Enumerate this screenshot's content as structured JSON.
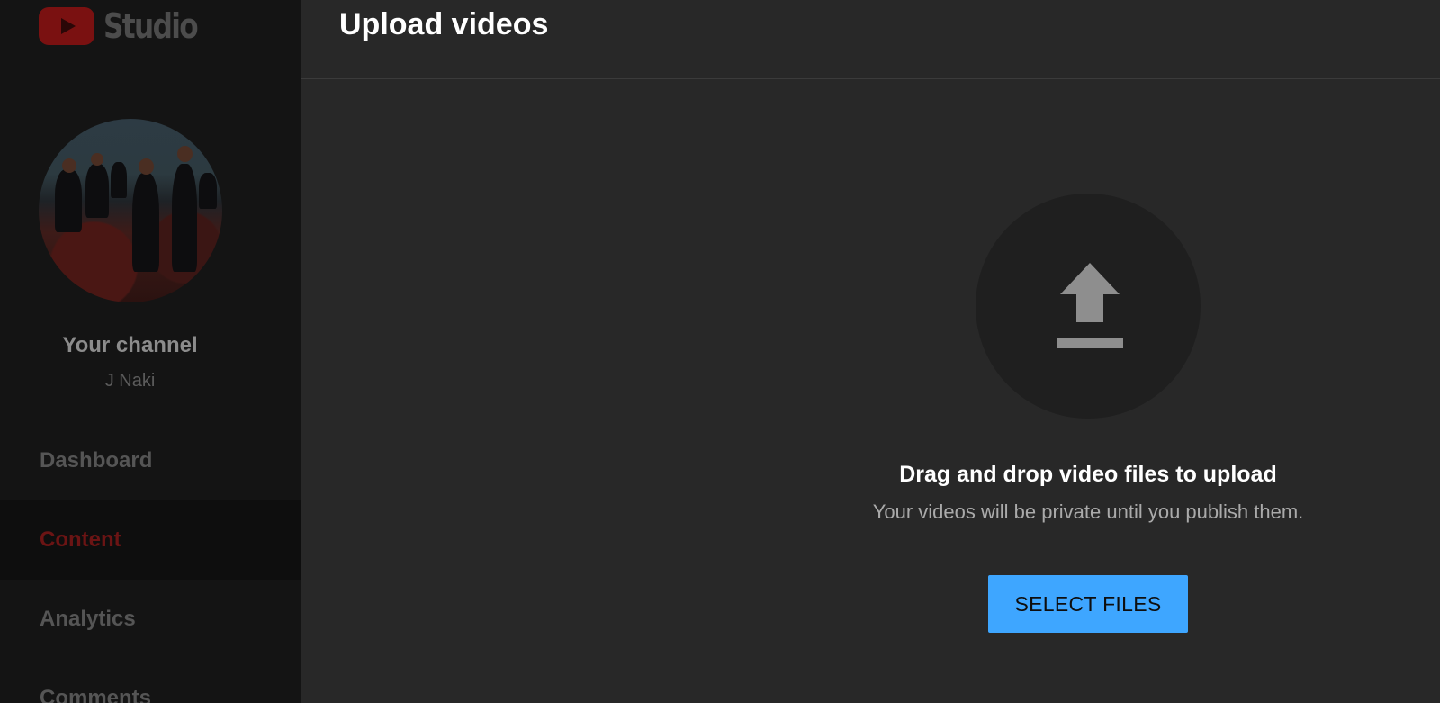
{
  "brand": {
    "logo_text": "Studio"
  },
  "channel": {
    "title": "Your channel",
    "name": "J Naki"
  },
  "sidebar": {
    "items": [
      {
        "label": "Dashboard",
        "active": false
      },
      {
        "label": "Content",
        "active": true
      },
      {
        "label": "Analytics",
        "active": false
      },
      {
        "label": "Comments",
        "active": false
      }
    ]
  },
  "modal": {
    "title": "Upload videos",
    "upload_icon": "upload-arrow-icon",
    "drop_title": "Drag and drop video files to upload",
    "drop_subtitle": "Your videos will be private until you publish them.",
    "select_button": "SELECT FILES"
  },
  "colors": {
    "accent_button": "#3ea6ff",
    "modal_bg": "#282828",
    "sidebar_bg": "#141414",
    "active_nav": "#6b1414"
  }
}
